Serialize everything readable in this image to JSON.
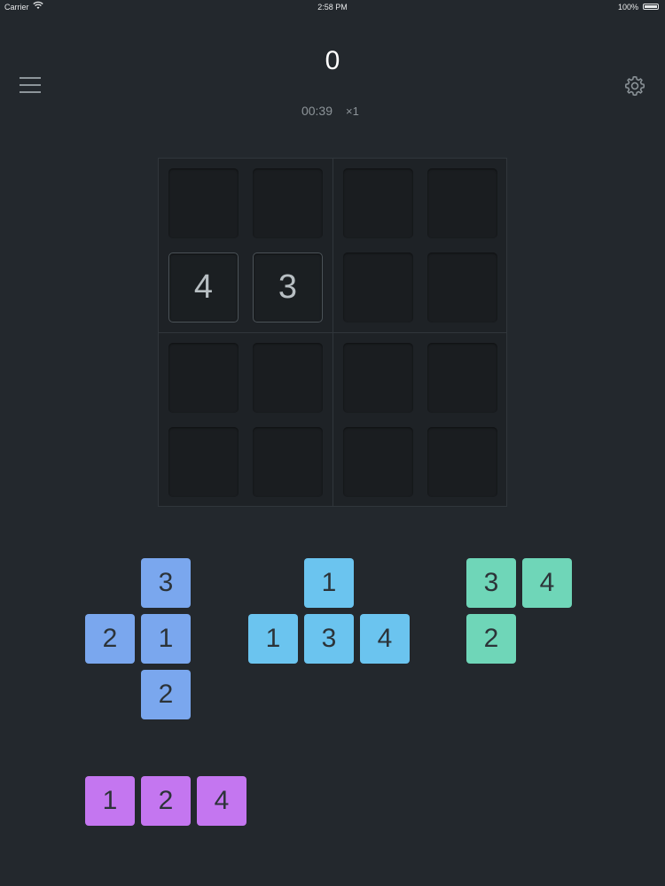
{
  "status_bar": {
    "carrier": "Carrier",
    "time": "2:58 PM",
    "battery": "100%"
  },
  "header": {
    "score": "0",
    "timer": "00:39",
    "multiplier": "×1"
  },
  "icons": {
    "menu": "hamburger-menu-icon",
    "settings": "gear-icon"
  },
  "board": {
    "rows": [
      [
        "",
        "",
        "",
        ""
      ],
      [
        "4",
        "3",
        "",
        ""
      ],
      [
        "",
        "",
        "",
        ""
      ],
      [
        "",
        "",
        "",
        ""
      ]
    ]
  },
  "pieces": [
    {
      "color": "#7aa7ee",
      "tiles": [
        {
          "row": 0,
          "col": 1,
          "value": "3"
        },
        {
          "row": 1,
          "col": 0,
          "value": "2"
        },
        {
          "row": 1,
          "col": 1,
          "value": "1"
        },
        {
          "row": 2,
          "col": 1,
          "value": "2"
        }
      ]
    },
    {
      "color": "#6bc4ef",
      "tiles": [
        {
          "row": 0,
          "col": 1,
          "value": "1"
        },
        {
          "row": 1,
          "col": 0,
          "value": "1"
        },
        {
          "row": 1,
          "col": 1,
          "value": "3"
        },
        {
          "row": 1,
          "col": 2,
          "value": "4"
        }
      ]
    },
    {
      "color": "#6fd6b8",
      "tiles": [
        {
          "row": 0,
          "col": 0,
          "value": "3"
        },
        {
          "row": 0,
          "col": 1,
          "value": "4"
        },
        {
          "row": 1,
          "col": 0,
          "value": "2"
        }
      ]
    },
    {
      "color": "#c476f0",
      "tiles": [
        {
          "row": 0,
          "col": 0,
          "value": "1"
        },
        {
          "row": 0,
          "col": 1,
          "value": "2"
        },
        {
          "row": 0,
          "col": 2,
          "value": "4"
        }
      ]
    }
  ]
}
